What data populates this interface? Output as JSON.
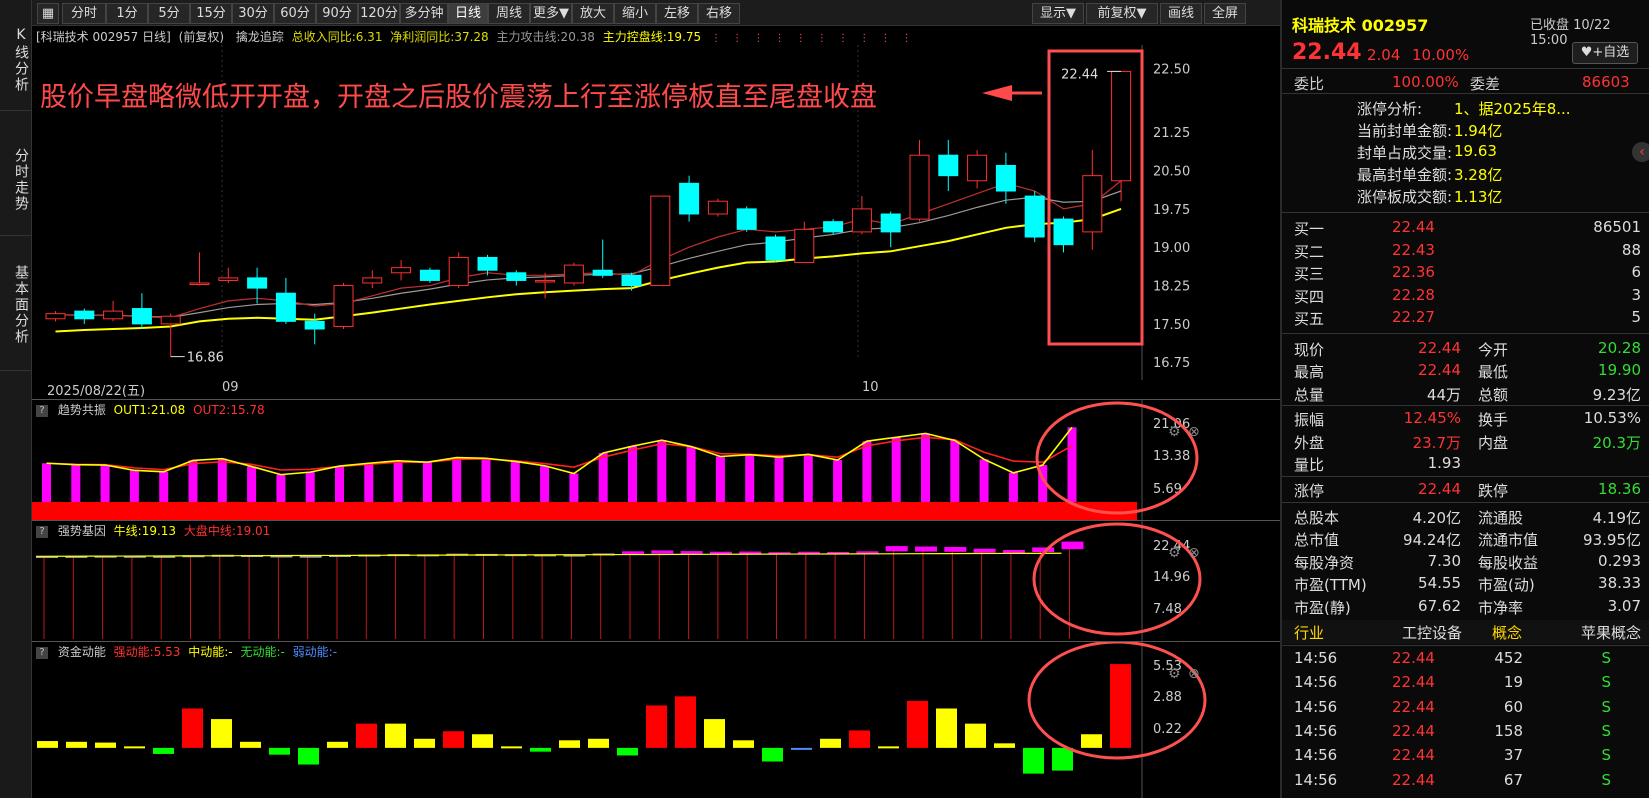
{
  "nav": [
    "K线分析",
    "分时走势",
    "基本面分析"
  ],
  "toolbar": {
    "left": [
      "分时",
      "1分",
      "5分",
      "15分",
      "30分",
      "60分",
      "90分",
      "120分",
      "多分钟",
      "日线",
      "周线",
      "更多▼",
      "放大",
      "缩小",
      "左移",
      "右移"
    ],
    "active": "日线",
    "right": [
      "显示▼",
      "前复权▼",
      "画线",
      "全屏"
    ]
  },
  "main_info": {
    "stock": "[科瑞技术 002957 日线]",
    "adjust": "(前复权)",
    "indicator": "擒龙追踪",
    "rev": "总收入同比:6.31",
    "profit": "净利润同比:37.28",
    "attack": "主力攻击线:20.38",
    "control": "主力控盘线:19.75"
  },
  "annotation": "股价早盘略微低开开盘，开盘之后股价震荡上行至涨停板直至尾盘收盘",
  "date_axis": {
    "first": "2025/08/22(五)",
    "m9": "09",
    "m10": "10"
  },
  "price_labels": {
    "low": "16.86",
    "high": "22.44"
  },
  "panels": {
    "trend": {
      "name": "趋势共振",
      "out1": "OUT1:21.08",
      "out2": "OUT2:15.78",
      "ticks": [
        "21.06",
        "13.38",
        "5.69"
      ]
    },
    "strong": {
      "name": "强势基因",
      "bull": "牛线:19.13",
      "mid": "大盘中线:19.01",
      "ticks": [
        "22.44",
        "14.96",
        "7.48"
      ]
    },
    "fund": {
      "name": "资金动能",
      "strong": "强动能:5.53",
      "midk": "中动能:-",
      "none": "无动能:-",
      "weak": "弱动能:-",
      "ticks": [
        "5.53",
        "2.88",
        "0.22"
      ]
    }
  },
  "colors": {
    "up": "#ff3030",
    "down": "#00ffff",
    "ma": "#ffff00",
    "magenta": "#ff00ff",
    "circle": "#ff5050"
  },
  "chart_data": [
    {
      "type": "candlestick",
      "title": "科瑞技术 002957 日线",
      "ylim": [
        16.5,
        22.8
      ],
      "yticks": [
        "22.50",
        "21.25",
        "20.50",
        "19.75",
        "19.00",
        "18.25",
        "17.50",
        "16.75"
      ],
      "candles": [
        {
          "o": 17.6,
          "c": 17.7,
          "h": 17.75,
          "l": 17.55
        },
        {
          "o": 17.75,
          "c": 17.6,
          "h": 17.8,
          "l": 17.5
        },
        {
          "o": 17.6,
          "c": 17.75,
          "h": 17.95,
          "l": 17.55
        },
        {
          "o": 17.8,
          "c": 17.5,
          "h": 18.1,
          "l": 17.4
        },
        {
          "o": 17.5,
          "c": 17.65,
          "h": 17.7,
          "l": 16.86
        },
        {
          "o": 18.3,
          "c": 18.3,
          "h": 18.9,
          "l": 18.25
        },
        {
          "o": 18.35,
          "c": 18.4,
          "h": 18.6,
          "l": 18.3
        },
        {
          "o": 18.4,
          "c": 18.2,
          "h": 18.6,
          "l": 17.9
        },
        {
          "o": 18.1,
          "c": 17.55,
          "h": 18.4,
          "l": 17.5
        },
        {
          "o": 17.55,
          "c": 17.4,
          "h": 17.7,
          "l": 17.1
        },
        {
          "o": 17.45,
          "c": 18.25,
          "h": 18.3,
          "l": 17.4
        },
        {
          "o": 18.3,
          "c": 18.4,
          "h": 18.55,
          "l": 18.2
        },
        {
          "o": 18.5,
          "c": 18.6,
          "h": 18.75,
          "l": 18.35
        },
        {
          "o": 18.55,
          "c": 18.35,
          "h": 18.6,
          "l": 18.3
        },
        {
          "o": 18.25,
          "c": 18.8,
          "h": 18.9,
          "l": 18.2
        },
        {
          "o": 18.8,
          "c": 18.55,
          "h": 18.85,
          "l": 18.45
        },
        {
          "o": 18.5,
          "c": 18.35,
          "h": 18.55,
          "l": 18.25
        },
        {
          "o": 18.35,
          "c": 18.35,
          "h": 18.5,
          "l": 18.0
        },
        {
          "o": 18.3,
          "c": 18.65,
          "h": 18.7,
          "l": 18.25
        },
        {
          "o": 18.55,
          "c": 18.45,
          "h": 19.15,
          "l": 18.4
        },
        {
          "o": 18.45,
          "c": 18.25,
          "h": 18.5,
          "l": 18.15
        },
        {
          "o": 18.25,
          "c": 20.0,
          "h": 20.0,
          "l": 18.25
        },
        {
          "o": 20.25,
          "c": 19.65,
          "h": 20.4,
          "l": 19.5
        },
        {
          "o": 19.65,
          "c": 19.9,
          "h": 19.95,
          "l": 19.6
        },
        {
          "o": 19.75,
          "c": 19.35,
          "h": 19.8,
          "l": 19.3
        },
        {
          "o": 19.2,
          "c": 18.75,
          "h": 19.25,
          "l": 18.7
        },
        {
          "o": 18.7,
          "c": 19.35,
          "h": 19.5,
          "l": 18.7
        },
        {
          "o": 19.5,
          "c": 19.3,
          "h": 19.55,
          "l": 19.25
        },
        {
          "o": 19.3,
          "c": 19.75,
          "h": 20.0,
          "l": 19.25
        },
        {
          "o": 19.65,
          "c": 19.3,
          "h": 19.7,
          "l": 19.0
        },
        {
          "o": 19.55,
          "c": 20.8,
          "h": 21.1,
          "l": 19.5
        },
        {
          "o": 20.8,
          "c": 20.4,
          "h": 21.1,
          "l": 20.1
        },
        {
          "o": 20.3,
          "c": 20.8,
          "h": 20.9,
          "l": 20.15
        },
        {
          "o": 20.6,
          "c": 20.1,
          "h": 20.85,
          "l": 19.85
        },
        {
          "o": 20.0,
          "c": 19.2,
          "h": 20.1,
          "l": 19.1
        },
        {
          "o": 19.55,
          "c": 19.05,
          "h": 19.6,
          "l": 18.9
        },
        {
          "o": 19.3,
          "c": 20.4,
          "h": 20.9,
          "l": 18.95
        },
        {
          "o": 20.3,
          "c": 22.44,
          "h": 22.44,
          "l": 19.9
        }
      ],
      "ma_red": [
        17.68,
        17.66,
        17.67,
        17.64,
        17.62,
        17.8,
        17.95,
        18.0,
        17.95,
        17.85,
        17.9,
        18.05,
        18.2,
        18.25,
        18.4,
        18.5,
        18.45,
        18.45,
        18.48,
        18.5,
        18.45,
        18.75,
        19.0,
        19.2,
        19.35,
        19.3,
        19.35,
        19.4,
        19.55,
        19.45,
        19.65,
        19.85,
        20.05,
        20.25,
        20.1,
        19.75,
        19.85,
        20.3
      ],
      "ma_gray": [
        17.68,
        17.67,
        17.67,
        17.65,
        17.63,
        17.72,
        17.82,
        17.88,
        17.9,
        17.88,
        17.92,
        18.0,
        18.1,
        18.18,
        18.28,
        18.36,
        18.4,
        18.42,
        18.45,
        18.47,
        18.48,
        18.62,
        18.78,
        18.92,
        19.05,
        19.1,
        19.18,
        19.25,
        19.35,
        19.38,
        19.48,
        19.62,
        19.78,
        19.92,
        19.98,
        19.88,
        19.9,
        20.1
      ],
      "ma_yellow": [
        17.35,
        17.38,
        17.4,
        17.42,
        17.45,
        17.55,
        17.6,
        17.62,
        17.6,
        17.58,
        17.65,
        17.72,
        17.8,
        17.88,
        17.95,
        18.02,
        18.08,
        18.12,
        18.15,
        18.18,
        18.2,
        18.35,
        18.48,
        18.6,
        18.7,
        18.72,
        18.78,
        18.82,
        18.88,
        18.92,
        19.02,
        19.12,
        19.25,
        19.38,
        19.45,
        19.48,
        19.55,
        19.75
      ]
    },
    {
      "type": "bar",
      "title": "趋势共振",
      "ylim": [
        0,
        22.5
      ],
      "values": [
        10.9,
        10.5,
        10.4,
        8.9,
        8.5,
        11.7,
        12.2,
        10.0,
        7.7,
        8.4,
        10.1,
        10.9,
        11.6,
        11.2,
        12.5,
        12.3,
        11.4,
        10.2,
        8.0,
        13.8,
        15.7,
        17.4,
        15.6,
        12.8,
        13.3,
        12.6,
        13.4,
        11.8,
        17.1,
        18.2,
        19.3,
        17.3,
        12.0,
        8.2,
        10.4,
        21.0
      ],
      "line_red": [
        10.9,
        10.6,
        10.5,
        9.6,
        9.1,
        10.8,
        11.3,
        10.6,
        9.0,
        9.2,
        10.0,
        10.6,
        11.2,
        11.2,
        12.0,
        12.1,
        11.6,
        10.8,
        9.8,
        12.6,
        14.6,
        16.4,
        15.6,
        13.6,
        13.4,
        13.0,
        13.3,
        12.6,
        15.8,
        17.2,
        18.2,
        17.5,
        14.0,
        11.5,
        11.2,
        15.8
      ],
      "line_yellow": [
        10.9,
        10.5,
        10.4,
        8.9,
        8.5,
        11.7,
        12.2,
        10.0,
        7.7,
        8.4,
        10.1,
        10.9,
        11.6,
        11.2,
        12.5,
        12.3,
        11.4,
        10.2,
        8.0,
        13.8,
        15.7,
        17.4,
        15.6,
        12.8,
        13.3,
        12.6,
        13.4,
        11.8,
        17.1,
        18.2,
        19.3,
        17.3,
        12.0,
        8.2,
        10.4,
        21.0
      ]
    },
    {
      "type": "bar",
      "title": "强势基因",
      "ylim": [
        0,
        23.5
      ],
      "values": [
        19.13,
        19.15,
        19.2,
        19.18,
        19.16,
        19.3,
        19.4,
        19.35,
        19.25,
        19.2,
        19.35,
        19.45,
        19.55,
        19.5,
        19.65,
        19.6,
        19.55,
        19.5,
        19.45,
        19.7,
        20.2,
        20.4,
        20.25,
        20.1,
        20.15,
        20.0,
        20.1,
        20.05,
        20.2,
        21.4,
        21.3,
        21.2,
        20.8,
        20.5,
        21.1,
        22.44
      ]
    },
    {
      "type": "bar",
      "title": "资金动能",
      "ylim": [
        -0.8,
        5.8
      ],
      "values": [
        0.45,
        0.4,
        0.35,
        0.1,
        -0.4,
        2.6,
        1.9,
        0.4,
        -0.45,
        -1.1,
        0.4,
        1.6,
        1.6,
        0.6,
        1.1,
        0.9,
        0.1,
        -0.25,
        0.5,
        0.6,
        -0.5,
        2.8,
        3.4,
        1.9,
        0.5,
        -0.9,
        -0.05,
        0.6,
        1.15,
        0.1,
        3.1,
        2.6,
        1.6,
        0.3,
        -1.7,
        -1.5,
        0.9,
        5.53
      ]
    }
  ],
  "right": {
    "title": "科瑞技术 002957",
    "status": "已收盘 10/22 15:00",
    "price": "22.44",
    "change": "2.04",
    "pct": "10.00%",
    "fav": "+自选",
    "weibi": {
      "l1": "委比",
      "v1": "100.00%",
      "l2": "委差",
      "v2": "86603"
    },
    "zt": [
      {
        "k": "涨停分析:",
        "v": "1、据2025年8..."
      },
      {
        "k": "当前封单金额:",
        "v": "1.94亿"
      },
      {
        "k": "封单占成交量:",
        "v": "19.63"
      },
      {
        "k": "最高封单金额:",
        "v": "3.28亿"
      },
      {
        "k": "涨停板成交额:",
        "v": "1.13亿"
      }
    ],
    "bids": [
      {
        "l": "买一",
        "p": "22.44",
        "v": "86501"
      },
      {
        "l": "买二",
        "p": "22.43",
        "v": "88"
      },
      {
        "l": "买三",
        "p": "22.36",
        "v": "6"
      },
      {
        "l": "买四",
        "p": "22.28",
        "v": "3"
      },
      {
        "l": "买五",
        "p": "22.27",
        "v": "5"
      }
    ],
    "stats1": [
      {
        "l1": "现价",
        "v1": "22.44",
        "c1": "red",
        "l2": "今开",
        "v2": "20.28",
        "c2": "green"
      },
      {
        "l1": "最高",
        "v1": "22.44",
        "c1": "red",
        "l2": "最低",
        "v2": "19.90",
        "c2": "green"
      },
      {
        "l1": "总量",
        "v1": "44万",
        "c1": "white",
        "l2": "总额",
        "v2": "9.23亿",
        "c2": "white"
      }
    ],
    "stats2": [
      {
        "l1": "振幅",
        "v1": "12.45%",
        "c1": "red",
        "l2": "换手",
        "v2": "10.53%",
        "c2": "white"
      },
      {
        "l1": "外盘",
        "v1": "23.7万",
        "c1": "red",
        "l2": "内盘",
        "v2": "20.3万",
        "c2": "green"
      },
      {
        "l1": "量比",
        "v1": "1.93",
        "c1": "white",
        "l2": "",
        "v2": "",
        "c2": "white"
      }
    ],
    "limit": {
      "l1": "涨停",
      "v1": "22.44",
      "l2": "跌停",
      "v2": "18.36"
    },
    "stats3": [
      {
        "l1": "总股本",
        "v1": "4.20亿",
        "l2": "流通股",
        "v2": "4.19亿"
      },
      {
        "l1": "总市值",
        "v1": "94.24亿",
        "l2": "流通市值",
        "v2": "93.95亿"
      },
      {
        "l1": "每股净资",
        "v1": "7.30",
        "l2": "每股收益",
        "v2": "0.293"
      },
      {
        "l1": "市盈(TTM)",
        "v1": "54.55",
        "l2": "市盈(动)",
        "v2": "38.33"
      },
      {
        "l1": "市盈(静)",
        "v1": "67.62",
        "l2": "市净率",
        "v2": "3.07"
      }
    ],
    "industry": {
      "l1": "行业",
      "v1": "工控设备",
      "l2": "概念",
      "v2": "苹果概念"
    },
    "ticks": [
      {
        "t": "14:56",
        "p": "22.44",
        "v": "452",
        "s": "S"
      },
      {
        "t": "14:56",
        "p": "22.44",
        "v": "19",
        "s": "S"
      },
      {
        "t": "14:56",
        "p": "22.44",
        "v": "60",
        "s": "S"
      },
      {
        "t": "14:56",
        "p": "22.44",
        "v": "158",
        "s": "S"
      },
      {
        "t": "14:56",
        "p": "22.44",
        "v": "37",
        "s": "S"
      },
      {
        "t": "14:56",
        "p": "22.44",
        "v": "67",
        "s": "S"
      }
    ]
  }
}
